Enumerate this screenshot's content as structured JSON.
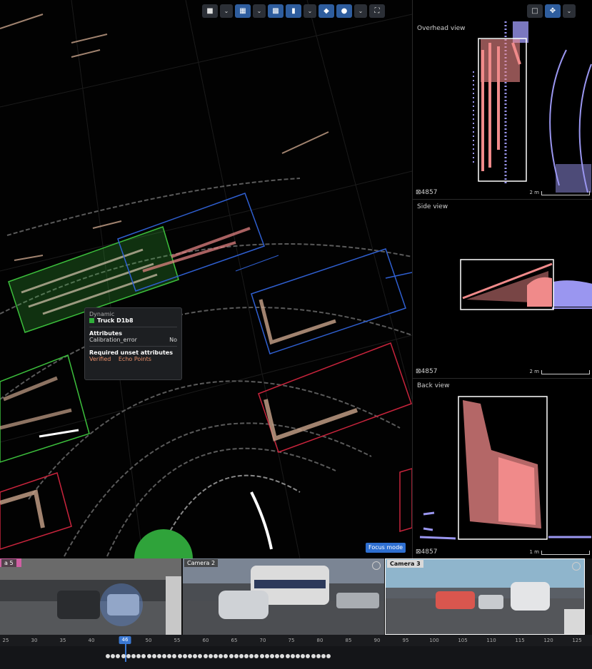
{
  "toolbar": {
    "main_icons": [
      "camera-icon",
      "layout-grid-icon",
      "checker-icon",
      "label-tag-icon",
      "layers-icon",
      "point-size-icon",
      "fullscreen-icon"
    ],
    "right_icons": [
      "box-view-icon",
      "move-icon"
    ]
  },
  "tooltip": {
    "category": "Dynamic",
    "name": "Truck D1b8",
    "color": "#2fae3a",
    "attributes_heading": "Attributes",
    "attr_key": "Calibration_error",
    "attr_value": "No",
    "required_heading": "Required unset attributes",
    "required": [
      "Verified",
      "Echo Points"
    ]
  },
  "focus_label": "Focus mode",
  "views": [
    {
      "title": "Overhead view",
      "count": "4857",
      "scale": "2 m"
    },
    {
      "title": "Side view",
      "count": "4857",
      "scale": "2 m"
    },
    {
      "title": "Back view",
      "count": "4857",
      "scale": "1 m"
    }
  ],
  "cameras": [
    {
      "label": "a 5"
    },
    {
      "label": "Camera 2"
    },
    {
      "label": "Camera 3"
    }
  ],
  "timeline": {
    "ticks": [
      "25",
      "30",
      "35",
      "40",
      "46",
      "50",
      "55",
      "60",
      "65",
      "70",
      "75",
      "80",
      "85",
      "90",
      "95",
      "100",
      "105",
      "110",
      "115",
      "120",
      "125"
    ],
    "current": "46"
  },
  "colors": {
    "accent": "#2e5d9e",
    "box_green": "#3cbf3c",
    "box_blue": "#2f5fd0",
    "box_red": "#c8243c",
    "points_pink": "#f08a8a",
    "points_violet": "#9a96f0"
  }
}
